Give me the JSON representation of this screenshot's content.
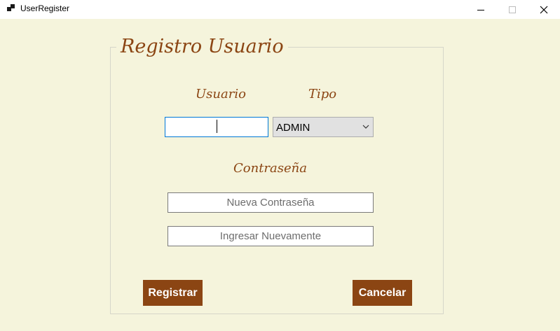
{
  "window": {
    "title": "UserRegister",
    "icon": "app-icon"
  },
  "form": {
    "title": "Registro Usuario",
    "usuario_label": "Usuario",
    "tipo_label": "Tipo",
    "contrasena_label": "Contraseña",
    "usuario_value": "",
    "tipo_selected": "ADMIN",
    "password_placeholder": "Nueva Contraseña",
    "password_confirm_placeholder": "Ingresar Nuevamente",
    "register_label": "Registrar",
    "cancel_label": "Cancelar"
  },
  "colors": {
    "background": "#F5F4DC",
    "accent": "#8B4513",
    "focus_border": "#0078D7"
  }
}
